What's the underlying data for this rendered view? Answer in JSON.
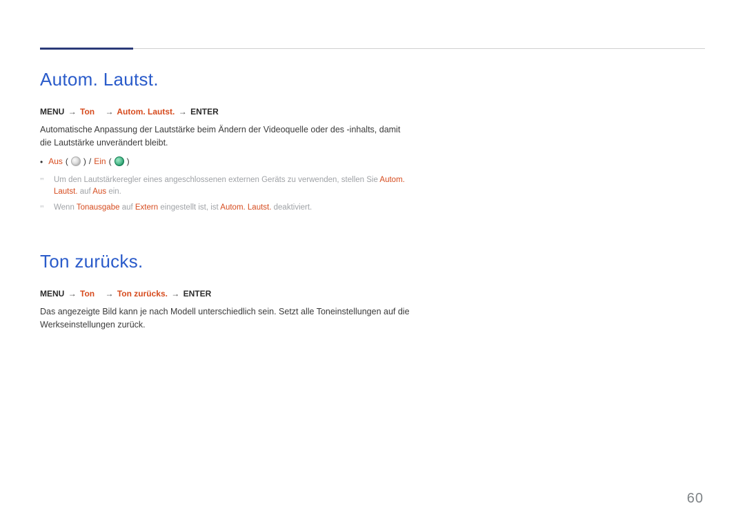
{
  "page_number": "60",
  "section1": {
    "heading": "Autom. Lautst.",
    "path": {
      "menu": "MENU",
      "ton": "Ton",
      "item": "Autom. Lautst.",
      "enter": "ENTER"
    },
    "body": "Automatische Anpassung der Lautstärke beim Ändern der Videoquelle oder des -inhalts, damit die Lautstärke unverändert bleibt.",
    "options": {
      "aus": "Aus",
      "ein": "Ein"
    },
    "notes": [
      {
        "pre": "Um den Lautstärkeregler eines angeschlossenen externen Geräts zu verwenden, stellen Sie ",
        "hl1": "Autom. Lautst.",
        "mid1": " auf ",
        "hl2": "Aus",
        "post": " ein."
      },
      {
        "pre": "Wenn ",
        "hl1": "Tonausgabe",
        "mid1": " auf ",
        "hl2": "Extern",
        "mid2": " eingestellt ist, ist ",
        "hl3": "Autom. Lautst.",
        "post": " deaktiviert."
      }
    ]
  },
  "section2": {
    "heading": "Ton zurücks.",
    "path": {
      "menu": "MENU",
      "ton": "Ton",
      "item": "Ton zurücks.",
      "enter": "ENTER"
    },
    "body": "Das angezeigte Bild kann je nach Modell unterschiedlich sein. Setzt alle Toneinstellungen auf die Werkseinstellungen zurück."
  }
}
